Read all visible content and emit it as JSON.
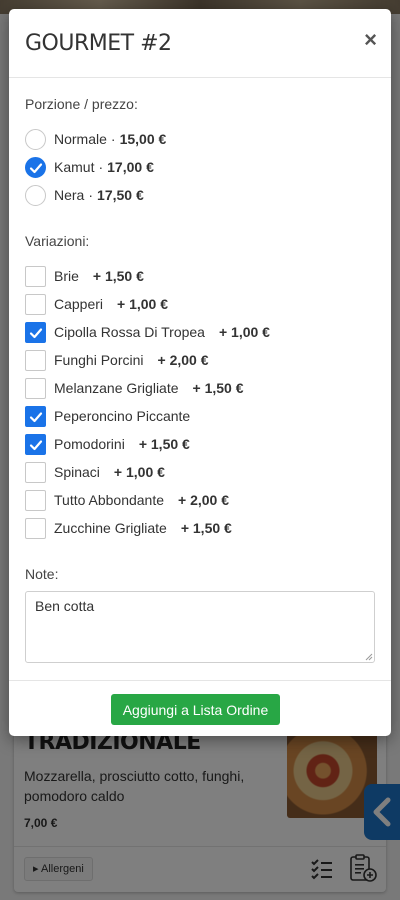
{
  "modal": {
    "title": "GOURMET #2",
    "close_label": "×",
    "portion_label": "Porzione / prezzo:",
    "portions": [
      {
        "name": "Normale",
        "sep": "·",
        "price": "15,00 €",
        "selected": false
      },
      {
        "name": "Kamut",
        "sep": "·",
        "price": "17,00 €",
        "selected": true
      },
      {
        "name": "Nera",
        "sep": "·",
        "price": "17,50 €",
        "selected": false
      }
    ],
    "variations_label": "Variazioni:",
    "variations": [
      {
        "name": "Brie",
        "price": "+ 1,50 €",
        "checked": false
      },
      {
        "name": "Capperi",
        "price": "+ 1,00 €",
        "checked": false
      },
      {
        "name": "Cipolla Rossa Di Tropea",
        "price": "+ 1,00 €",
        "checked": true
      },
      {
        "name": "Funghi Porcini",
        "price": "+ 2,00 €",
        "checked": false
      },
      {
        "name": "Melanzane Grigliate",
        "price": "+ 1,50 €",
        "checked": false
      },
      {
        "name": "Peperoncino Piccante",
        "price": "",
        "checked": true
      },
      {
        "name": "Pomodorini",
        "price": "+ 1,50 €",
        "checked": true
      },
      {
        "name": "Spinaci",
        "price": "+ 1,00 €",
        "checked": false
      },
      {
        "name": "Tutto Abbondante",
        "price": "+ 2,00 €",
        "checked": false
      },
      {
        "name": "Zucchine Grigliate",
        "price": "+ 1,50 €",
        "checked": false
      }
    ],
    "notes_label": "Note:",
    "notes_value": "Ben cotta",
    "add_button": "Aggiungi a Lista Ordine"
  },
  "background_card": {
    "title": "TRADIZIONALE",
    "description": "Mozzarella, prosciutto cotto, funghi, pomodoro caldo",
    "price": "7,00 €",
    "allergens_label": "Allergeni",
    "allergens_icon": "caret-right-icon"
  },
  "colors": {
    "accent": "#1a73e8",
    "button_green": "#28a745",
    "side_tab": "#1d74c9"
  }
}
